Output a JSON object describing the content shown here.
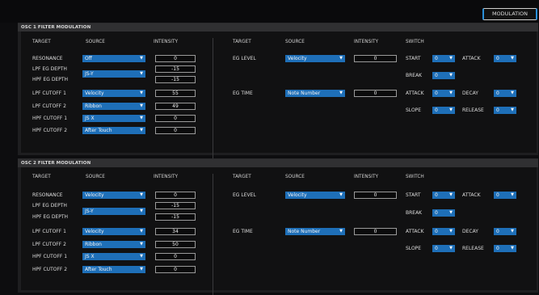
{
  "header": {
    "modulation_label": "MODULATION"
  },
  "osc1": {
    "title": "OSC 1 FILTER MODULATION",
    "cols": {
      "target": "TARGET",
      "source": "SOURCE",
      "intensity": "INTENSITY",
      "target2": "TARGET",
      "source2": "SOURCE",
      "intensity2": "INTENSITY",
      "switch": "SWITCH"
    },
    "rows": [
      {
        "target": "RESONANCE",
        "source": "Off",
        "intensity": "0"
      },
      {
        "target": "LPF EG DEPTH",
        "intensity": "-15"
      },
      {
        "target": "HPF EG DEPTH",
        "intensity": "-15"
      },
      {
        "target": "LPF CUTOFF 1",
        "source": "Velocity",
        "intensity": "55"
      },
      {
        "target": "LPF CUTOFF 2",
        "source": "Ribbon",
        "intensity": "49"
      },
      {
        "target": "HPF CUTOFF 1",
        "source": "JS X",
        "intensity": "0"
      },
      {
        "target": "HPF CUTOFF 2",
        "source": "After Touch",
        "intensity": "0"
      }
    ],
    "eg_depth_source": "JS-Y",
    "eg_level": {
      "label": "EG LEVEL",
      "source": "Velocity",
      "intensity": "0"
    },
    "eg_time": {
      "label": "EG TIME",
      "source": "Note Number",
      "intensity": "0"
    },
    "switches": {
      "start": {
        "label": "START",
        "value": "0"
      },
      "attack": {
        "label": "ATTACK",
        "value": "0"
      },
      "break": {
        "label": "BREAK",
        "value": "0"
      },
      "attack2": {
        "label": "ATTACK",
        "value": "0"
      },
      "decay": {
        "label": "DECAY",
        "value": "0"
      },
      "slope": {
        "label": "SLOPE",
        "value": "0"
      },
      "release": {
        "label": "RELEASE",
        "value": "0"
      }
    }
  },
  "osc2": {
    "title": "OSC 2 FILTER MODULATION",
    "cols": {
      "target": "TARGET",
      "source": "SOURCE",
      "intensity": "INTENSITY",
      "target2": "TARGET",
      "source2": "SOURCE",
      "intensity2": "INTENSITY",
      "switch": "SWITCH"
    },
    "rows": [
      {
        "target": "RESONANCE",
        "source": "Velocity",
        "intensity": "0"
      },
      {
        "target": "LPF EG DEPTH",
        "intensity": "-15"
      },
      {
        "target": "HPF EG DEPTH",
        "intensity": "-15"
      },
      {
        "target": "LPF CUTOFF 1",
        "source": "Velocity",
        "intensity": "34"
      },
      {
        "target": "LPF CUTOFF 2",
        "source": "Ribbon",
        "intensity": "50"
      },
      {
        "target": "HPF CUTOFF 1",
        "source": "JS X",
        "intensity": "0"
      },
      {
        "target": "HPF CUTOFF 2",
        "source": "After Touch",
        "intensity": "0"
      }
    ],
    "eg_depth_source": "JS-Y",
    "eg_level": {
      "label": "EG LEVEL",
      "source": "Velocity",
      "intensity": "0"
    },
    "eg_time": {
      "label": "EG TIME",
      "source": "Note Number",
      "intensity": "0"
    },
    "switches": {
      "start": {
        "label": "START",
        "value": "0"
      },
      "attack": {
        "label": "ATTACK",
        "value": "0"
      },
      "break": {
        "label": "BREAK",
        "value": "0"
      },
      "attack2": {
        "label": "ATTACK",
        "value": "0"
      },
      "decay": {
        "label": "DECAY",
        "value": "0"
      },
      "slope": {
        "label": "SLOPE",
        "value": "0"
      },
      "release": {
        "label": "RELEASE",
        "value": "0"
      }
    }
  }
}
